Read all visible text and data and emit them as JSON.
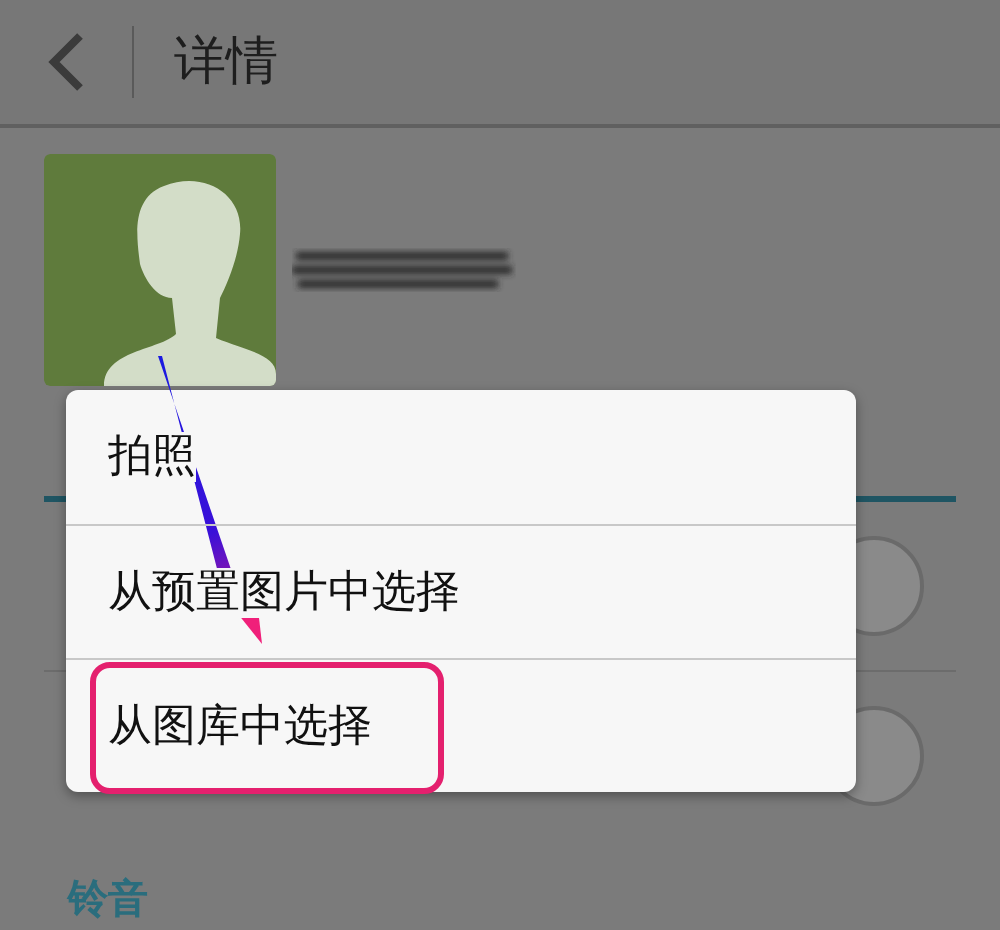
{
  "header": {
    "title": "详情"
  },
  "photo_menu": {
    "options": [
      {
        "label": "拍照",
        "highlighted": false
      },
      {
        "label": "从预置图片中选择",
        "highlighted": false
      },
      {
        "label": "从图库中选择",
        "highlighted": true
      }
    ]
  },
  "section": {
    "label": "铃音"
  }
}
